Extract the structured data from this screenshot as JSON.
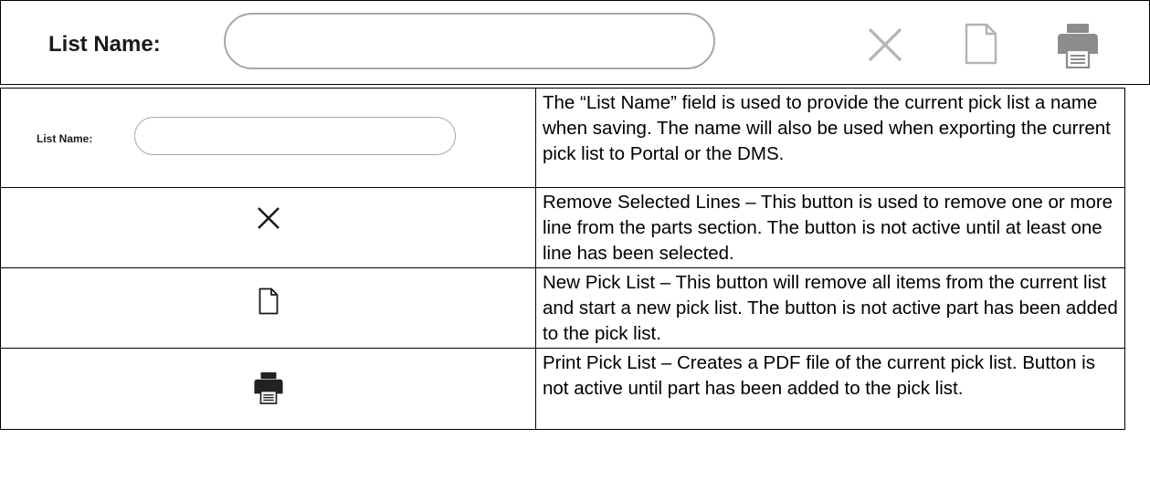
{
  "toolbar": {
    "list_name_label": "List Name:",
    "list_name_value": "",
    "icons": [
      "close-icon",
      "new-document-icon",
      "printer-icon"
    ],
    "icon_color": "#b5b5b5",
    "print_icon_color": "#8c8c8c"
  },
  "table": {
    "rows": [
      {
        "left_kind": "list-name-preview",
        "left_label": "List Name:",
        "description": "The “List Name” field is used to provide the current pick list a name when saving.  The name will also be used when exporting the current pick list to Portal or the DMS."
      },
      {
        "left_kind": "icon",
        "left_icon": "close-icon",
        "description": "Remove Selected Lines – This button is used to remove one or more line from the parts section.  The button is not active until at least one line has been selected."
      },
      {
        "left_kind": "icon",
        "left_icon": "new-document-icon",
        "description": "New Pick List – This button will remove all items from the current list and start a new pick list.  The button is not active part has been added to the pick list."
      },
      {
        "left_kind": "icon",
        "left_icon": "printer-icon",
        "description": "Print Pick List – Creates a PDF file of the current pick list.  Button is not active until part has been added to the pick list."
      }
    ]
  }
}
